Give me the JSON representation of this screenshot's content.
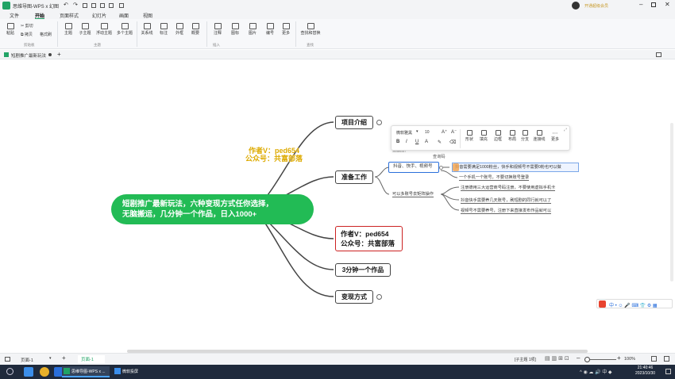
{
  "titlebar": {
    "app_title": "思维导图-WPS x 幻图",
    "user_badge": "开通超级会员"
  },
  "menu": {
    "items": [
      "文件",
      "开始",
      "页面样式",
      "幻灯片",
      "画面",
      "视图"
    ],
    "active_index": 1
  },
  "ribbon": {
    "clipboard": {
      "paste": "粘贴",
      "cut": "剪切",
      "copy": "拷贝",
      "format": "格式刷",
      "group": "剪贴板"
    },
    "topic": {
      "items": [
        "主题",
        "子主题",
        "浮动主题",
        "多个主题"
      ],
      "group": "主题"
    },
    "insert": {
      "items": [
        "关系线",
        "标注",
        "外框",
        "概要",
        "注释",
        "图标",
        "图片",
        "编号",
        "更多"
      ],
      "group": "插入"
    },
    "find": {
      "label": "查找和替换",
      "group": "查找"
    }
  },
  "doc_tab": {
    "title": "短剧推广最新玩法",
    "add": "+"
  },
  "mindmap": {
    "root": "短剧推广最新玩法，六种变现方式任你选择，无脑搬运，几分钟一个作品，日入1000+",
    "root_line1": "短剧推广最新玩法，六种变现方式任你选择，",
    "root_line2": "无脑搬运，几分钟一个作品，日入1000+",
    "watermark_line1": "作者V：ped654",
    "watermark_line2": "公众号：共富部落",
    "branches": {
      "b1": "项目介绍",
      "b2": "准备工作",
      "b3_line1": "作者V：ped654",
      "b3_line2": "公众号：共富部落",
      "b4": "3分钟一个作品",
      "b5": "变现方式"
    },
    "prep": {
      "platforms": "抖音、快手、视频号",
      "platform_tag": "查询码",
      "small_note": "360abc357",
      "requirement": "抖音需要满足1000粉丝，快手和视频号不需要0粉也可以做",
      "one_phone": "一个手机一个账号，不要切换账号登录",
      "matrix": "可以多账号去矩阵操作",
      "matrix_items": [
        "注册德用三大运营商号码注册，不要使用虚拟手机卡",
        "抖音快手需要养几天账号，刷短剧的同行就可以了",
        "视频号不需要养号，注册下来直接发布作品就可以"
      ]
    },
    "toolbar": {
      "font": "微软雅黑",
      "size": "10",
      "labels": [
        "形状",
        "填充",
        "边框",
        "布局",
        "分支",
        "连接线",
        "更多"
      ]
    }
  },
  "statusbar": {
    "page": "页面-1",
    "page_tab": "页面-1",
    "count": "[子主题 1项]",
    "zoom": "100%"
  },
  "taskbar": {
    "app1": "思维导图-WPS x ...",
    "app2": "微软投屏",
    "time": "21:40:46",
    "date": "2023/10/30"
  },
  "colors": {
    "accent": "#21a366",
    "root": "#22bb55",
    "watermark": "#ddaa00",
    "branch_red": "#cc2222"
  }
}
